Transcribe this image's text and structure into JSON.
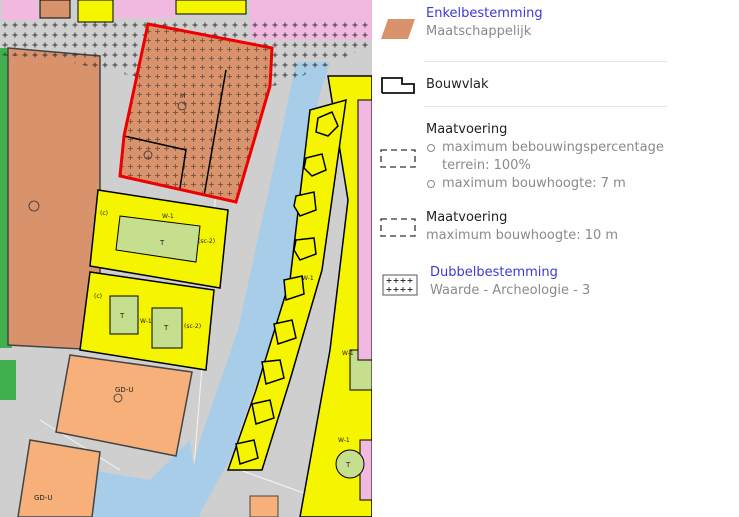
{
  "legend": {
    "enkelbestemming": {
      "title": "Enkelbestemming",
      "subtitle": "Maatschappelijk",
      "icon": "orange-parallelogram-icon",
      "color": "#d9936c"
    },
    "bouwvlak": {
      "label": "Bouwvlak",
      "icon": "bouwvlak-outline-icon"
    },
    "maatvoering_1": {
      "title": "Maatvoering",
      "bullets": [
        "maximum bebouwingspercentage terrein: 100%",
        "maximum bouwhoogte: 7 m"
      ],
      "icon": "dashed-rectangle-icon"
    },
    "maatvoering_2": {
      "title": "Maatvoering",
      "subtitle": "maximum bouwhoogte: 10 m",
      "icon": "dashed-rectangle-icon"
    },
    "dubbelbestemming": {
      "title": "Dubbelbestemming",
      "subtitle": "Waarde - Archeologie - 3",
      "icon": "crosses-rectangle-icon"
    }
  },
  "map": {
    "labels": {
      "m": "M",
      "w1": "W-1",
      "t": "T",
      "c": "(c)",
      "gdu": "GD-U",
      "sc2": "(sc-2)"
    },
    "colors": {
      "maatschappelijk": "#d9936c",
      "wonen": "#f5f500",
      "tuin": "#c5df8f",
      "gemengd": "#f7b07a",
      "water": "#a8cde8",
      "verkeer": "#cfcfcf",
      "groen": "#3fb04d",
      "purple": "#f1b9df",
      "selection": "#ee0000"
    }
  }
}
